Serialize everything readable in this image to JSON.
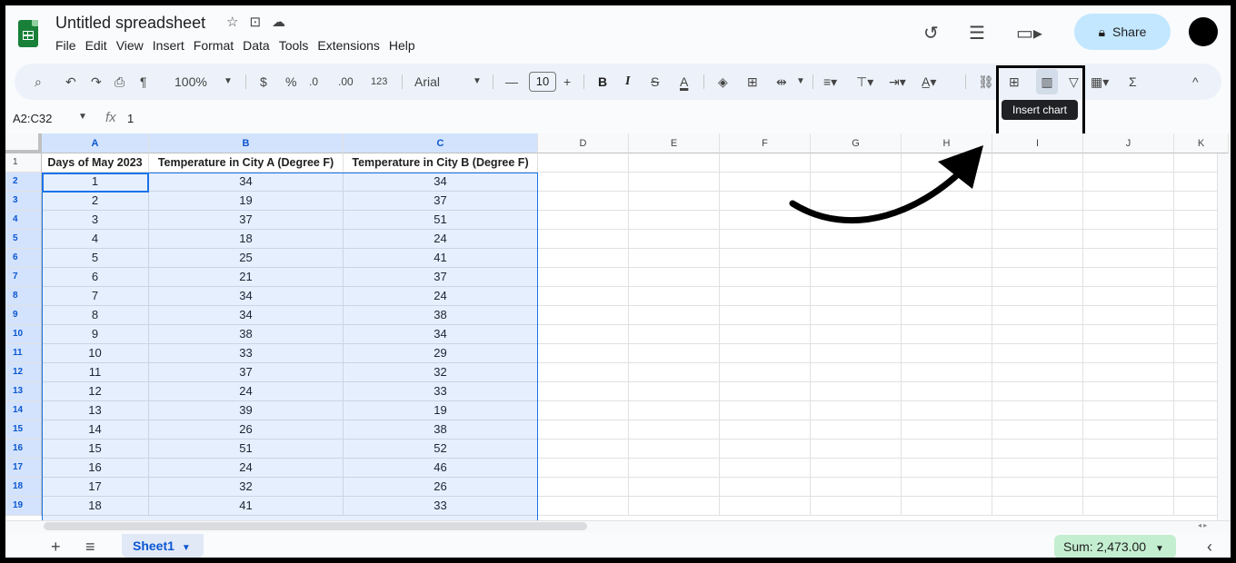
{
  "doc": {
    "title": "Untitled spreadsheet"
  },
  "menu": [
    "File",
    "Edit",
    "View",
    "Insert",
    "Format",
    "Data",
    "Tools",
    "Extensions",
    "Help"
  ],
  "header": {
    "share_label": "Share"
  },
  "toolbar": {
    "zoom": "100%",
    "currency": "$",
    "percent": "%",
    "dec_less": ".0",
    "dec_more": ".00",
    "num_format": "123",
    "font": "Arial",
    "font_size": "10",
    "bold": "B",
    "italic": "I",
    "sigma": "Σ",
    "tooltip": "Insert chart"
  },
  "formula_bar": {
    "name_box": "A2:C32",
    "fx_label": "fx",
    "value": "1"
  },
  "columns": [
    "A",
    "B",
    "C",
    "D",
    "E",
    "F",
    "G",
    "H",
    "I",
    "J",
    "K"
  ],
  "headers": [
    "Days of May 2023",
    "Temperature in City A (Degree F)",
    "Temperature in City B (Degree F)"
  ],
  "rows": [
    [
      "1",
      "34",
      "34"
    ],
    [
      "2",
      "19",
      "37"
    ],
    [
      "3",
      "37",
      "51"
    ],
    [
      "4",
      "18",
      "24"
    ],
    [
      "5",
      "25",
      "41"
    ],
    [
      "6",
      "21",
      "37"
    ],
    [
      "7",
      "34",
      "24"
    ],
    [
      "8",
      "34",
      "38"
    ],
    [
      "9",
      "38",
      "34"
    ],
    [
      "10",
      "33",
      "29"
    ],
    [
      "11",
      "37",
      "32"
    ],
    [
      "12",
      "24",
      "33"
    ],
    [
      "13",
      "39",
      "19"
    ],
    [
      "14",
      "26",
      "38"
    ],
    [
      "15",
      "51",
      "52"
    ],
    [
      "16",
      "24",
      "46"
    ],
    [
      "17",
      "32",
      "26"
    ],
    [
      "18",
      "41",
      "33"
    ]
  ],
  "row_numbers": [
    "1",
    "2",
    "3",
    "4",
    "5",
    "6",
    "7",
    "8",
    "9",
    "10",
    "11",
    "12",
    "13",
    "14",
    "15",
    "16",
    "17",
    "18",
    "19"
  ],
  "bottom": {
    "sheet_name": "Sheet1",
    "sum": "Sum: 2,473.00"
  },
  "colors": {
    "selection": "#1a73e8",
    "share_bg": "#c2e7ff",
    "sheets_green": "#188038"
  }
}
